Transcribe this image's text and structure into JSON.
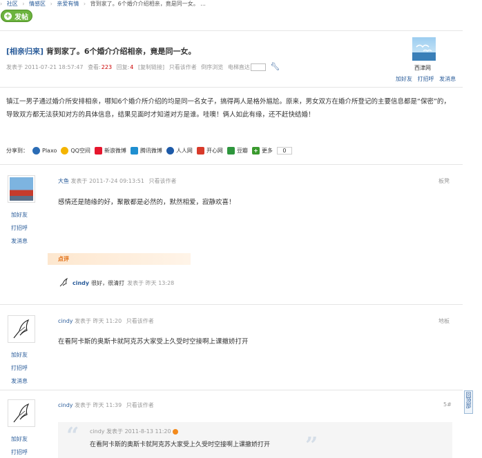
{
  "breadcrumb": [
    "社区",
    "情感区",
    "亲爱有情",
    "背到家了。6个婚介介绍相亲，竟是同一女。 ..."
  ],
  "post_button": "发帖",
  "thread": {
    "category": "[相亲归来]",
    "title": "背到家了。6个婚介介绍相亲，竟是同一女。",
    "meta_posted": "发表于 2011-07-21 18:57:47",
    "views_label": "查看:",
    "views": "223",
    "replies_label": "回复:",
    "replies": "4",
    "copy_link": "[复制链接]",
    "only_author": "只看该作者",
    "reverse": "倒序浏览",
    "jump_label": "电梯直达",
    "content": "镇江一男子通过婚介所安排相亲，哪知6个婚介所介绍的均是同一名女子，搞得两人是格外尴尬。原来，男女双方在婚介所登记的主要信息都是“保密”的，导致双方都无法获知对方的具体信息，结果见面时才知道对方是谁。哇噢！俩人如此有缘，还不赶快结婚！"
  },
  "op": {
    "name": "西津网",
    "links": [
      "加好友",
      "打招呼",
      "发消息"
    ]
  },
  "share": {
    "label": "分享到：",
    "items": [
      {
        "label": "Plaxo",
        "icon": "plaxo-icon",
        "color": "#2b6cb5"
      },
      {
        "label": "QQ空间",
        "icon": "qzone-icon",
        "color": "#f4b400"
      },
      {
        "label": "新浪微博",
        "icon": "sina-weibo-icon",
        "color": "#e6162d"
      },
      {
        "label": "腾讯微博",
        "icon": "tencent-weibo-icon",
        "color": "#1f8fd0"
      },
      {
        "label": "人人网",
        "icon": "renren-icon",
        "color": "#1d5aa8"
      },
      {
        "label": "开心网",
        "icon": "kaixin-icon",
        "color": "#d83a2a"
      },
      {
        "label": "豆瓣",
        "icon": "douban-icon",
        "color": "#2e963d"
      },
      {
        "label": "更多",
        "icon": "more-icon",
        "color": "#3a9a2e"
      }
    ],
    "count": "0"
  },
  "posts": [
    {
      "author": "大鱼",
      "posted": "发表于 2011-7-24 09:13:51",
      "only_author": "只看该作者",
      "floor": "板凳",
      "content": "感情还是随缘的好，聚散都是必然的，默然相爱，寂静欢喜！",
      "side_links": [
        "加好友",
        "打招呼",
        "发消息"
      ],
      "comment_label": "点评",
      "comment": {
        "name": "cindy",
        "text": "很好，很清打",
        "time": "发表于 昨天 13:28"
      }
    },
    {
      "author": "cindy",
      "posted": "发表于 昨天 11:20",
      "only_author": "只看该作者",
      "floor": "地板",
      "content": "在看阿卡斯的奥斯卡就阿克苏大家受上久受时空接啊上课撤娇打开",
      "side_links": [
        "加好友",
        "打招呼",
        "发消息"
      ]
    },
    {
      "author": "cindy",
      "posted": "发表于 昨天 11:39",
      "only_author": "只看该作者",
      "floor": "5#",
      "side_links": [
        "加好友",
        "打招呼"
      ],
      "quote": {
        "meta": "cindy 发表于 2011-8-13 11:20",
        "text": "在看阿卡斯的奥斯卡就阿克苏大家受上久受时空接啊上课撤娇打开"
      }
    }
  ],
  "float_tab": "回顶部"
}
